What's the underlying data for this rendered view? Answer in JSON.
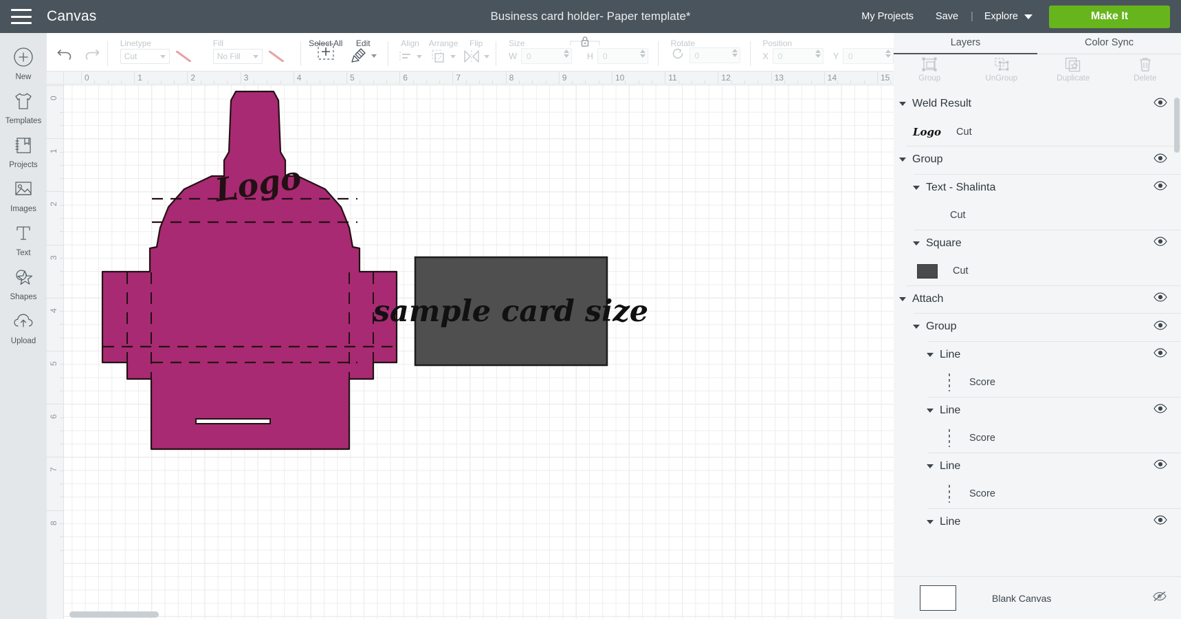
{
  "header": {
    "menu_icon": "hamburger-icon",
    "canvas_label": "Canvas",
    "document_title": "Business card holder- Paper template*",
    "my_projects": "My Projects",
    "save": "Save",
    "separator": "|",
    "explore": "Explore",
    "make_it": "Make It",
    "bg_color": "#4a545c",
    "make_it_color": "#67b51c"
  },
  "rail": {
    "items": [
      {
        "label": "New",
        "icon": "plus-circle-icon"
      },
      {
        "label": "Templates",
        "icon": "tshirt-icon"
      },
      {
        "label": "Projects",
        "icon": "notebook-bookmark-icon"
      },
      {
        "label": "Images",
        "icon": "photo-icon"
      },
      {
        "label": "Text",
        "icon": "text-t-icon"
      },
      {
        "label": "Shapes",
        "icon": "shapes-star-icon"
      },
      {
        "label": "Upload",
        "icon": "cloud-upload-icon"
      }
    ]
  },
  "toolbar": {
    "undo": "undo-icon",
    "redo": "redo-icon",
    "linetype": {
      "label": "Linetype",
      "value": "Cut"
    },
    "fill": {
      "label": "Fill",
      "value": "No Fill"
    },
    "select_all": "Select All",
    "edit": "Edit",
    "align": "Align",
    "arrange": "Arrange",
    "flip": "Flip",
    "size": {
      "label": "Size",
      "w_label": "W",
      "w_value": "0",
      "h_label": "H",
      "h_value": "0",
      "lock": "lock-icon"
    },
    "rotate": {
      "label": "Rotate",
      "value": "0"
    },
    "position": {
      "label": "Position",
      "x_label": "X",
      "x_value": "0",
      "y_label": "Y",
      "y_value": "0"
    }
  },
  "canvas": {
    "ruler_h": [
      "0",
      "1",
      "2",
      "3",
      "4",
      "5",
      "6",
      "7",
      "8",
      "9",
      "10",
      "11",
      "12",
      "13",
      "14",
      "15"
    ],
    "ruler_v": [
      "0",
      "1",
      "2",
      "3",
      "4",
      "5",
      "6",
      "7",
      "8"
    ],
    "artwork": {
      "card_holder_color": "#a82a72",
      "card_holder_stroke": "#231014",
      "logo_text": "Logo",
      "sample_card_color": "#4f4f4f",
      "sample_card_stroke": "#1d1d1d",
      "sample_card_text": "sample card size"
    }
  },
  "right_panel": {
    "tabs": [
      {
        "label": "Layers",
        "active": true
      },
      {
        "label": "Color Sync",
        "active": false
      }
    ],
    "actions": [
      {
        "label": "Group",
        "icon": "group-icon"
      },
      {
        "label": "UnGroup",
        "icon": "ungroup-icon"
      },
      {
        "label": "Duplicate",
        "icon": "duplicate-icon"
      },
      {
        "label": "Delete",
        "icon": "trash-icon"
      }
    ],
    "layers": [
      {
        "title": "Weld Result",
        "type": "group",
        "indent": 0,
        "caret": true,
        "eye": "visible"
      },
      {
        "title": "Cut",
        "type": "child-logo",
        "indent": 1,
        "caret": false,
        "eye": "none",
        "thumb": "Logo"
      },
      {
        "title": "Group",
        "type": "group",
        "indent": 0,
        "caret": true,
        "eye": "visible"
      },
      {
        "title": "Text - Shalinta",
        "type": "group",
        "indent": 1,
        "caret": true,
        "eye": "visible"
      },
      {
        "title": "Cut",
        "type": "child-plain",
        "indent": 2,
        "caret": false,
        "eye": "none"
      },
      {
        "title": "Square",
        "type": "group",
        "indent": 1,
        "caret": true,
        "eye": "visible"
      },
      {
        "title": "Cut",
        "type": "child-swatch",
        "indent": 2,
        "caret": false,
        "eye": "none",
        "swatch": "#4a4a4a"
      },
      {
        "title": "Attach",
        "type": "group",
        "indent": 0,
        "caret": true,
        "eye": "visible"
      },
      {
        "title": "Group",
        "type": "group",
        "indent": 1,
        "caret": true,
        "eye": "visible"
      },
      {
        "title": "Line",
        "type": "group",
        "indent": 2,
        "caret": true,
        "eye": "visible"
      },
      {
        "title": "Score",
        "type": "child-dash",
        "indent": 3,
        "caret": false,
        "eye": "none"
      },
      {
        "title": "Line",
        "type": "group",
        "indent": 2,
        "caret": true,
        "eye": "visible"
      },
      {
        "title": "Score",
        "type": "child-dash",
        "indent": 3,
        "caret": false,
        "eye": "none"
      },
      {
        "title": "Line",
        "type": "group",
        "indent": 2,
        "caret": true,
        "eye": "visible"
      },
      {
        "title": "Score",
        "type": "child-dash",
        "indent": 3,
        "caret": false,
        "eye": "none"
      },
      {
        "title": "Line",
        "type": "group",
        "indent": 2,
        "caret": true,
        "eye": "visible"
      }
    ],
    "blank_canvas": {
      "label": "Blank Canvas",
      "eye": "hidden"
    }
  }
}
